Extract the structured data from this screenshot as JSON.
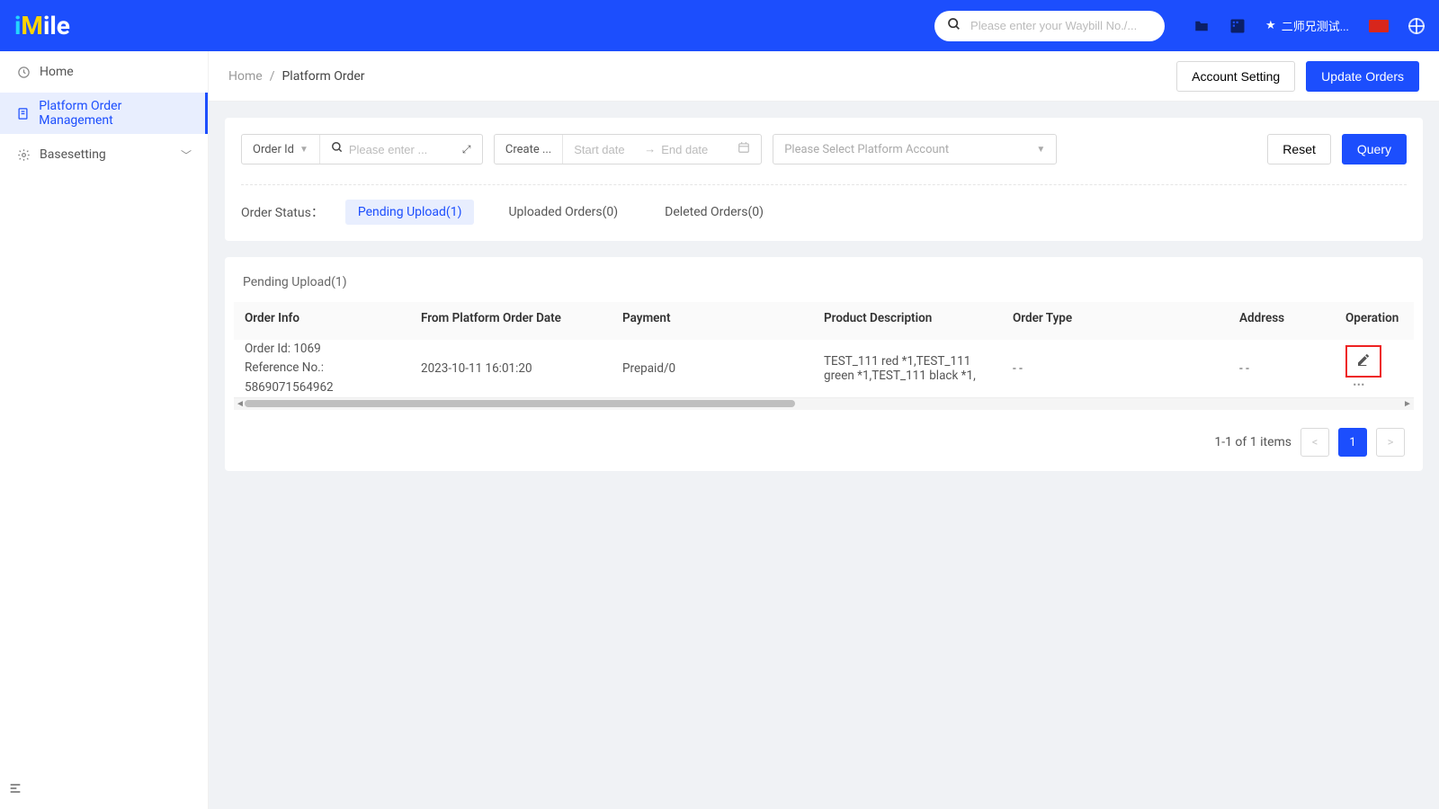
{
  "header": {
    "logo_i": "i",
    "logo_m": "M",
    "logo_ile": "ile",
    "search_placeholder": "Please enter your Waybill No./...",
    "user_label": "二师兄测试..."
  },
  "sidebar": {
    "home": "Home",
    "platform_order_mgmt": "Platform Order Management",
    "basesetting": "Basesetting"
  },
  "breadcrumb": {
    "home": "Home",
    "sep": "/",
    "current": "Platform Order"
  },
  "actions": {
    "account_setting": "Account Setting",
    "update_orders": "Update Orders"
  },
  "filters": {
    "order_id_label": "Order Id",
    "order_id_placeholder": "Please enter ...",
    "create_label": "Create ...",
    "start_date_placeholder": "Start date",
    "arrow": "→",
    "end_date_placeholder": "End date",
    "platform_account_placeholder": "Please Select Platform Account",
    "reset": "Reset",
    "query": "Query"
  },
  "status": {
    "label": "Order Status：",
    "pending_upload": "Pending Upload(1)",
    "uploaded": "Uploaded Orders(0)",
    "deleted": "Deleted Orders(0)"
  },
  "table": {
    "title": "Pending Upload(1)",
    "cols": {
      "info": "Order Info",
      "date": "From Platform Order Date",
      "payment": "Payment",
      "desc": "Product Description",
      "type": "Order Type",
      "addr": "Address",
      "op": "Operation"
    },
    "rows": [
      {
        "info_l1": "Order Id: 1069",
        "info_l2": "Reference No.: 5869071564962",
        "date": "2023-10-11 16:01:20",
        "payment": "Prepaid/0",
        "desc": "TEST_111 red *1,TEST_111 green *1,TEST_111 black *1,",
        "type": "- -",
        "addr": "- -"
      }
    ]
  },
  "pager": {
    "text": "1-1 of 1 items",
    "page": "1"
  }
}
